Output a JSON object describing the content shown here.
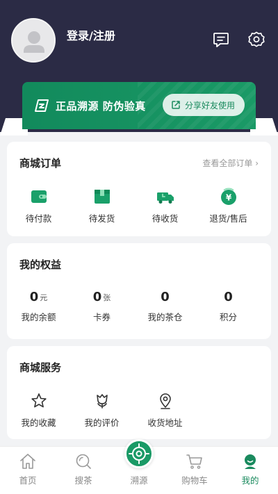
{
  "header": {
    "login_label": "登录/注册",
    "icons": [
      "message-icon",
      "gear-icon"
    ]
  },
  "banner": {
    "text": "正品溯源  防伪验真",
    "share_label": "分享好友使用",
    "accent": "#1a9a66"
  },
  "orders": {
    "title": "商城订单",
    "view_all": "查看全部订单 ›",
    "items": [
      {
        "label": "待付款",
        "icon": "wallet-icon"
      },
      {
        "label": "待发货",
        "icon": "package-icon"
      },
      {
        "label": "待收货",
        "icon": "truck-icon"
      },
      {
        "label": "退货/售后",
        "icon": "refund-icon"
      }
    ]
  },
  "benefits": {
    "title": "我的权益",
    "stats": [
      {
        "value": "0",
        "unit": "元",
        "label": "我的余额"
      },
      {
        "value": "0",
        "unit": "张",
        "label": "卡券"
      },
      {
        "value": "0",
        "unit": "",
        "label": "我的茶仓"
      },
      {
        "value": "0",
        "unit": "",
        "label": "积分"
      }
    ]
  },
  "services": {
    "title": "商城服务",
    "items": [
      {
        "label": "我的收藏",
        "icon": "star-icon"
      },
      {
        "label": "我的评价",
        "icon": "flower-icon"
      },
      {
        "label": "收货地址",
        "icon": "location-icon"
      }
    ]
  },
  "tabbar": {
    "tabs": [
      {
        "label": "首页",
        "icon": "home-icon"
      },
      {
        "label": "搜茶",
        "icon": "search-icon"
      },
      {
        "label": "溯源",
        "icon": "target-icon"
      },
      {
        "label": "购物车",
        "icon": "cart-icon"
      },
      {
        "label": "我的",
        "icon": "profile-icon"
      }
    ],
    "active_color": "#1a8a5e"
  }
}
